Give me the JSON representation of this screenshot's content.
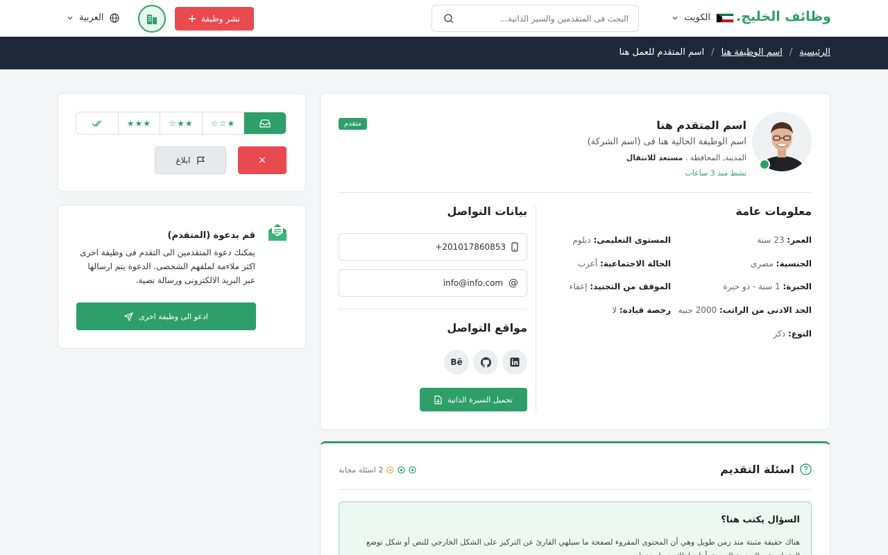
{
  "header": {
    "logo": "وظائف الخليج",
    "logo_dot": ".",
    "country": "الكويت",
    "search_placeholder": "البحث فى المتقدمين والسير الذاتية...",
    "post_job": "نشر وظيفة",
    "language": "العربية"
  },
  "breadcrumb": {
    "home": "الرئيسية",
    "job": "اسم الوظيفة هنا",
    "current": "اسم المتقدم للعمل هنا",
    "sep": "/"
  },
  "profile": {
    "name": "اسم المتقدم هنا",
    "role": "اسم الوظيفة الحالية هنا فى (اسم الشركة)",
    "location": "المدينة, المحافظة .",
    "relocate": "مستعد للانتقال",
    "active": "نشط منذ 3 ساعات",
    "badge": "متقدم"
  },
  "general_info": {
    "title": "معلومات عامة",
    "right": [
      {
        "label": "العمر:",
        "value": "23 سنة"
      },
      {
        "label": "الجنسية:",
        "value": "مصرى"
      },
      {
        "label": "الخبرة:",
        "value": "1 سنة - ذو خبرة"
      },
      {
        "label": "الحد الادنى من الراتب:",
        "value": "2000 جنيه"
      },
      {
        "label": "النوع:",
        "value": "ذكر"
      }
    ],
    "left": [
      {
        "label": "المستوى التعليمى:",
        "value": "دبلوم"
      },
      {
        "label": "الحالة الاجتماعية:",
        "value": "أعزب"
      },
      {
        "label": "الموقف من التجنيد:",
        "value": "إعفاء"
      },
      {
        "label": "رخصة قيادة:",
        "value": "لا"
      }
    ]
  },
  "contact": {
    "title": "بيانات التواصل",
    "phone": "+201017860853",
    "email": "info@info.com",
    "social_title": "مواقع التواصل",
    "behance": "Bē",
    "download_cv": "تحميل السيرة الذاتية"
  },
  "questions": {
    "title": "اسئلة التقديم",
    "answered": "2 اسئلة مجابة",
    "q1_title": "السؤال يكتب هنا؟",
    "q1_text": "هناك حقيقة مثبتة منذ زمن طويل وهي أن المحتوى المقروء لصفحة ما سيلهي القارئ عن التركيز على الشكل الخارجي للنص أو شكل توضع الفقرات في الصفحة التي يقرأها. ولذلك يتم استخدام"
  },
  "actions": {
    "rating": {
      "stars_1": "★☆☆",
      "stars_2": "★★☆",
      "stars_3": "★★★"
    },
    "report": "ابلاغ",
    "reject": "×"
  },
  "invite": {
    "title": "قم بدعوة (المتقدم)",
    "text": "يمكنك دعوة المتقدمين الى التقدم فى وظيفة اخرى اكثر ملاءمة لملفهم الشخصى. الدعوة يتم ارسالها عبر البريد الالكترونى ورسالة نصية.",
    "button": "ادعو الى وظيفة اخرى"
  },
  "colors": {
    "brand_green": "#2e9f6a",
    "danger_red": "#e84a4f",
    "nav_dark": "#1f2838"
  }
}
